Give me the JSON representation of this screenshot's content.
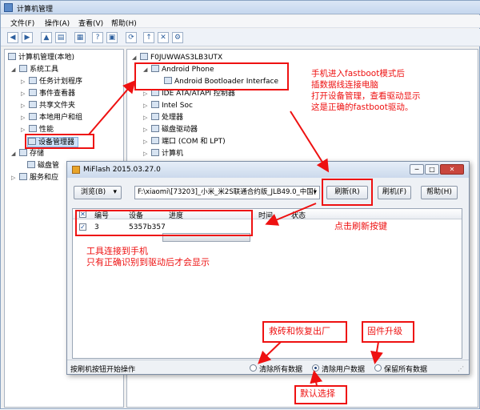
{
  "window": {
    "title": "计算机管理"
  },
  "menu": [
    "文件(F)",
    "操作(A)",
    "查看(V)",
    "帮助(H)"
  ],
  "tree_left": {
    "root": "计算机管理(本地)",
    "system_tools": "系统工具",
    "items": [
      "任务计划程序",
      "事件查看器",
      "共享文件夹",
      "本地用户和组",
      "性能",
      "设备管理器"
    ],
    "storage": "存储",
    "disk": "磁盘管",
    "services": "服务和应"
  },
  "tree_right": {
    "computer": "F0JUWWAS3LB3UTX",
    "android_phone": "Android Phone",
    "bootloader": "Android Bootloader Interface",
    "nodes": [
      "IDE ATA/ATAPI 控制器",
      "Intel Soc",
      "处理器",
      "磁盘驱动器",
      "端口 (COM 和 LPT)",
      "计算机"
    ]
  },
  "miflash": {
    "title": "MiFlash 2015.03.27.0",
    "browse_label": "浏览(B)",
    "path_value": "F:\\xiaomi\\[73203]_小米_米2S联通合约版_JLB49.0_中国(",
    "refresh_label": "刷新(R)",
    "flash_label": "刷机(F)",
    "help_label": "帮助(H)",
    "columns": [
      "编号",
      "设备",
      "进度",
      "时间",
      "状态"
    ],
    "rows": [
      {
        "checked": true,
        "num": "3",
        "device": "5357b357",
        "progress": 0
      }
    ],
    "status_text": "按刷机按钮开始操作",
    "options": [
      {
        "label": "清除所有数据",
        "selected": false
      },
      {
        "label": "清除用户数据",
        "selected": true
      },
      {
        "label": "保留所有数据",
        "selected": false
      }
    ]
  },
  "annotations": {
    "fastboot": [
      "手机进入fastboot模式后",
      "插数据线连接电脑",
      "打开设备管理，查看驱动显示",
      "这是正确的fastboot驱动。"
    ],
    "click_refresh": "点击刷新按键",
    "tool_connected": [
      "工具连接到手机",
      "只有正确识别到驱动后才会显示"
    ],
    "unbrick": "救砖和恢复出厂",
    "firmware": "固件升级",
    "default": "默认选择"
  },
  "colors": {
    "annotation": "#e11111",
    "title_bar": "#c5d7ee",
    "selection": "#cfe3fb"
  }
}
